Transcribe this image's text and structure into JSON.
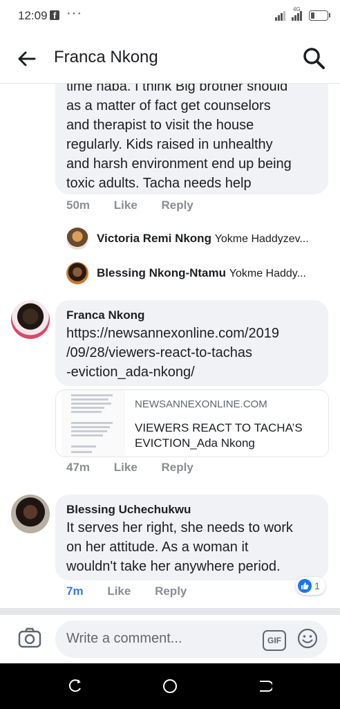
{
  "status_bar": {
    "time": "12:09",
    "fb_glyph": "f",
    "dots": "···",
    "network": "4G"
  },
  "header": {
    "title": "Franca Nkong"
  },
  "comments": [
    {
      "id": "c1",
      "partial_lines": [
        "time naba. I think Big brother should",
        "as a matter of fact  get counselors",
        "and therapist to visit the house",
        "regularly. Kids raised in unhealthy",
        "and harsh environment end up being",
        "toxic adults. Tacha needs help"
      ],
      "time": "50m",
      "like": "Like",
      "reply": "Reply",
      "replies": [
        {
          "name": "Victoria Remi Nkong",
          "snippet": "Yokme Haddyzev..."
        },
        {
          "name": "Blessing Nkong-Ntamu",
          "snippet": "Yokme Haddy..."
        }
      ]
    },
    {
      "id": "c2",
      "author": "Franca Nkong",
      "link_lines": [
        "https://newsannexonline.com/2019",
        "/09/28/viewers-react-to-tachas",
        "-eviction_ada-nkong/"
      ],
      "preview": {
        "domain": "NEWSANNEXONLINE.COM",
        "title": "VIEWERS REACT TO TACHA’S EVICTION_Ada Nkong"
      },
      "time": "47m",
      "like": "Like",
      "reply": "Reply"
    },
    {
      "id": "c3",
      "author": "Blessing Uchechukwu",
      "lines": [
        "It serves her right, she needs to work",
        "on her attitude. As a woman it",
        "wouldn't take her anywhere period."
      ],
      "reaction_count": "1",
      "time": "7m",
      "like": "Like",
      "reply": "Reply"
    }
  ],
  "composer": {
    "placeholder": "Write a comment...",
    "gif_label": "GIF"
  },
  "colors": {
    "bubble": "#f0f2f5",
    "link": "#4a6b9a",
    "accent": "#1877f2",
    "meta": "#8a8d91"
  }
}
